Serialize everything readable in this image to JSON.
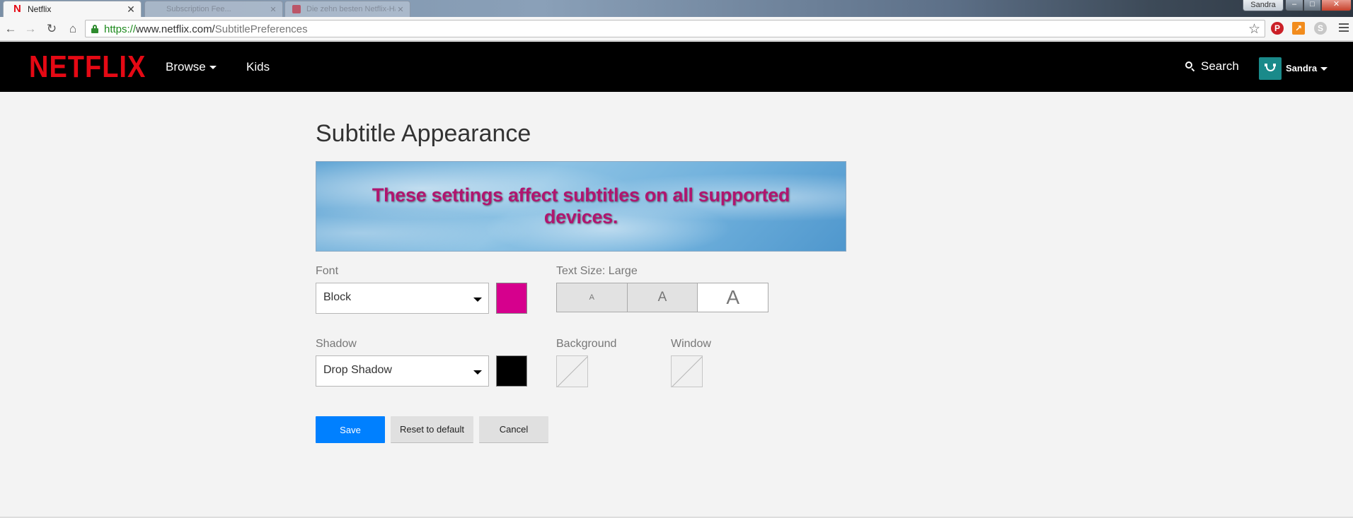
{
  "browser": {
    "tabs": [
      {
        "title": "Netflix",
        "active": true
      },
      {
        "title": "Subscription Fee...",
        "active": false
      },
      {
        "title": "Die zehn besten Netflix-Hacks...",
        "active": false
      }
    ],
    "user_label": "Sandra",
    "url": {
      "scheme": "https://",
      "host": "www.netflix.com/",
      "path": "SubtitlePreferences"
    }
  },
  "netflix": {
    "logo": "NETFLIX",
    "nav": {
      "browse": "Browse",
      "kids": "Kids"
    },
    "search_label": "Search",
    "profile_name": "Sandra"
  },
  "page": {
    "title": "Subtitle Appearance",
    "preview_text": "These settings affect subtitles on all supported devices.",
    "font": {
      "label": "Font",
      "value": "Block",
      "color": "#d6008d"
    },
    "text_size": {
      "label": "Text Size: Large",
      "options": [
        "A",
        "A",
        "A"
      ],
      "selected": "Large"
    },
    "shadow": {
      "label": "Shadow",
      "value": "Drop Shadow",
      "color": "#000000"
    },
    "background": {
      "label": "Background"
    },
    "window": {
      "label": "Window"
    },
    "buttons": {
      "save": "Save",
      "reset": "Reset to default",
      "cancel": "Cancel"
    }
  },
  "colors": {
    "brand_red": "#e50914",
    "primary_blue": "#0080ff",
    "preview_text": "#b0156f"
  }
}
